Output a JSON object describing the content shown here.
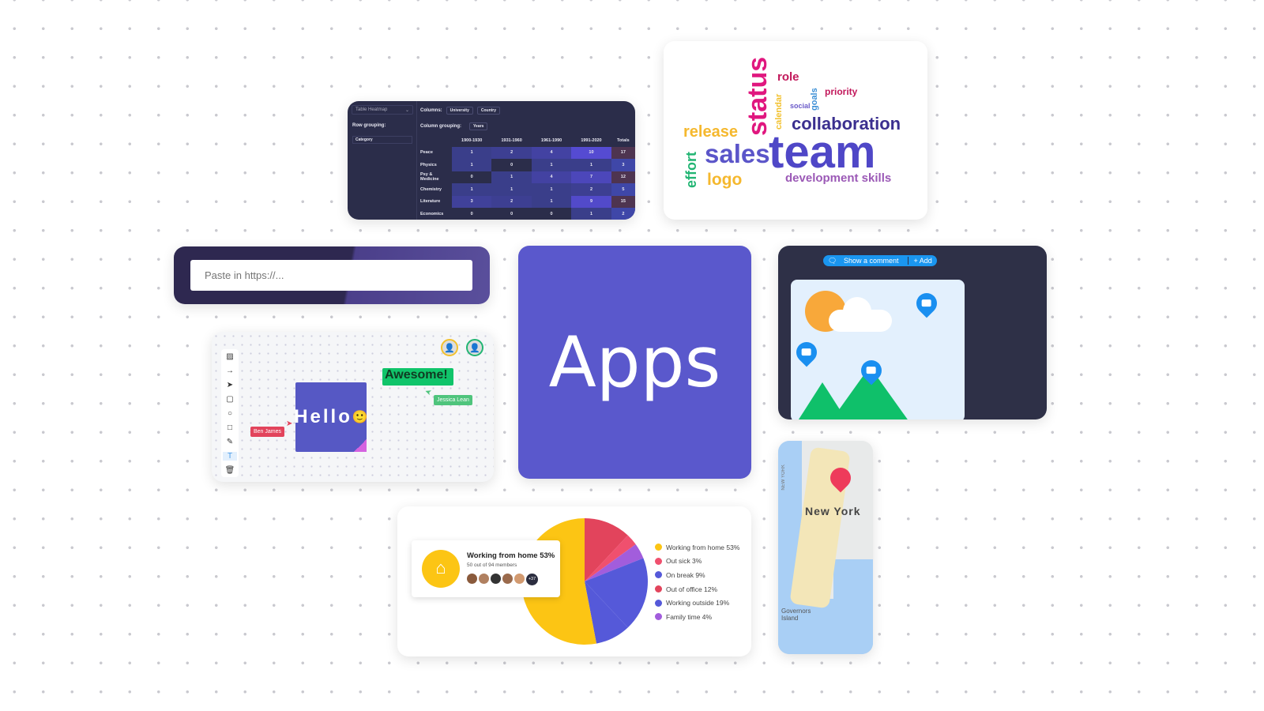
{
  "heatmap": {
    "selector": "Table Heatmap",
    "columns_label": "Columns:",
    "column_chips": [
      "University",
      "Country"
    ],
    "row_grouping_label": "Row grouping:",
    "row_chip": "Category",
    "column_grouping_label": "Column grouping:",
    "column_grouping_chip": "Years",
    "headers": [
      "",
      "1900-1930",
      "1931-1960",
      "1961-1990",
      "1991-2020",
      "Totals"
    ],
    "rows": [
      [
        "Peace",
        1,
        2,
        4,
        10,
        17
      ],
      [
        "Physics",
        1,
        0,
        1,
        1,
        3
      ],
      [
        "Psy & Medicine",
        0,
        1,
        4,
        7,
        12
      ],
      [
        "Chemistry",
        1,
        1,
        1,
        2,
        5
      ],
      [
        "Literature",
        3,
        2,
        1,
        9,
        15
      ],
      [
        "Economics",
        0,
        0,
        0,
        1,
        2
      ]
    ]
  },
  "wordcloud": {
    "words": [
      {
        "text": "status",
        "color": "#e0177f"
      },
      {
        "text": "role",
        "color": "#c2185b"
      },
      {
        "text": "calendar",
        "color": "#f2c12e"
      },
      {
        "text": "social",
        "color": "#6a5ac9"
      },
      {
        "text": "goals",
        "color": "#3d8fd6"
      },
      {
        "text": "priority",
        "color": "#c2185b"
      },
      {
        "text": "collaboration",
        "color": "#3b2f8f"
      },
      {
        "text": "release",
        "color": "#f5b82e"
      },
      {
        "text": "sales",
        "color": "#5b55c9"
      },
      {
        "text": "team",
        "color": "#4f47c7"
      },
      {
        "text": "effort",
        "color": "#22b573"
      },
      {
        "text": "logo",
        "color": "#f5b82e"
      },
      {
        "text": "development skills",
        "color": "#9b59b6"
      }
    ]
  },
  "paste": {
    "placeholder": "Paste in https://..."
  },
  "whiteboard": {
    "sticky": "Hello",
    "sticky_emoji": "🙂",
    "awesome": "Awesome!",
    "user1": "Ben James",
    "user2": "Jessica Lean"
  },
  "apps": {
    "title": "Apps"
  },
  "comments": {
    "show_label": "Show a comment",
    "add_label": "+ Add"
  },
  "map": {
    "city": "New York",
    "island": "Governors Island",
    "vertical_label": "NEW YORK"
  },
  "status_chart": {
    "tooltip_title": "Working from home 53%",
    "tooltip_sub": "50 out of 94 members",
    "more_count": "+37",
    "chart_data": {
      "type": "pie",
      "series": [
        {
          "name": "Working from home 53%",
          "value": 53,
          "color": "#fcc514"
        },
        {
          "name": "Out sick 3%",
          "value": 3,
          "color": "#f0506e"
        },
        {
          "name": "On break 9%",
          "value": 9,
          "color": "#5559d9"
        },
        {
          "name": "Out of office 12%",
          "value": 12,
          "color": "#e2445c"
        },
        {
          "name": "Working outside 19%",
          "value": 19,
          "color": "#5559d9"
        },
        {
          "name": "Family time 4%",
          "value": 4,
          "color": "#a25ddc"
        }
      ]
    }
  }
}
